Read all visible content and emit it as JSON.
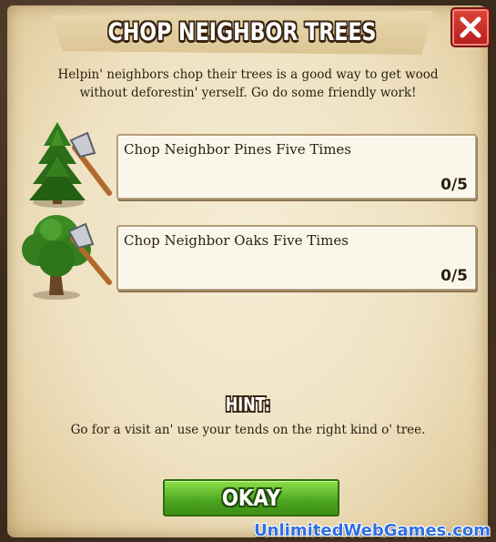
{
  "dialog": {
    "title": "CHOP NEIGHBOR TREES",
    "intro": "Helpin' neighbors chop their trees is a good way to get wood without deforestin' yerself. Go do some friendly work!",
    "close_icon": "close-x-icon"
  },
  "tasks": [
    {
      "label": "Chop Neighbor Pines Five Times",
      "progress": "0/5",
      "icon": "pine-tree-axe-icon"
    },
    {
      "label": "Chop Neighbor Oaks Five Times",
      "progress": "0/5",
      "icon": "oak-tree-axe-icon"
    }
  ],
  "hint": {
    "title": "HINT:",
    "text": "Go for a visit an' use your tends on the right kind o' tree."
  },
  "buttons": {
    "okay": "OKAY"
  },
  "watermark": "UnlimitedWebGames.com",
  "colors": {
    "close_red": "#c62a22",
    "okay_green": "#4aa51f",
    "parchment": "#efe2c2"
  }
}
